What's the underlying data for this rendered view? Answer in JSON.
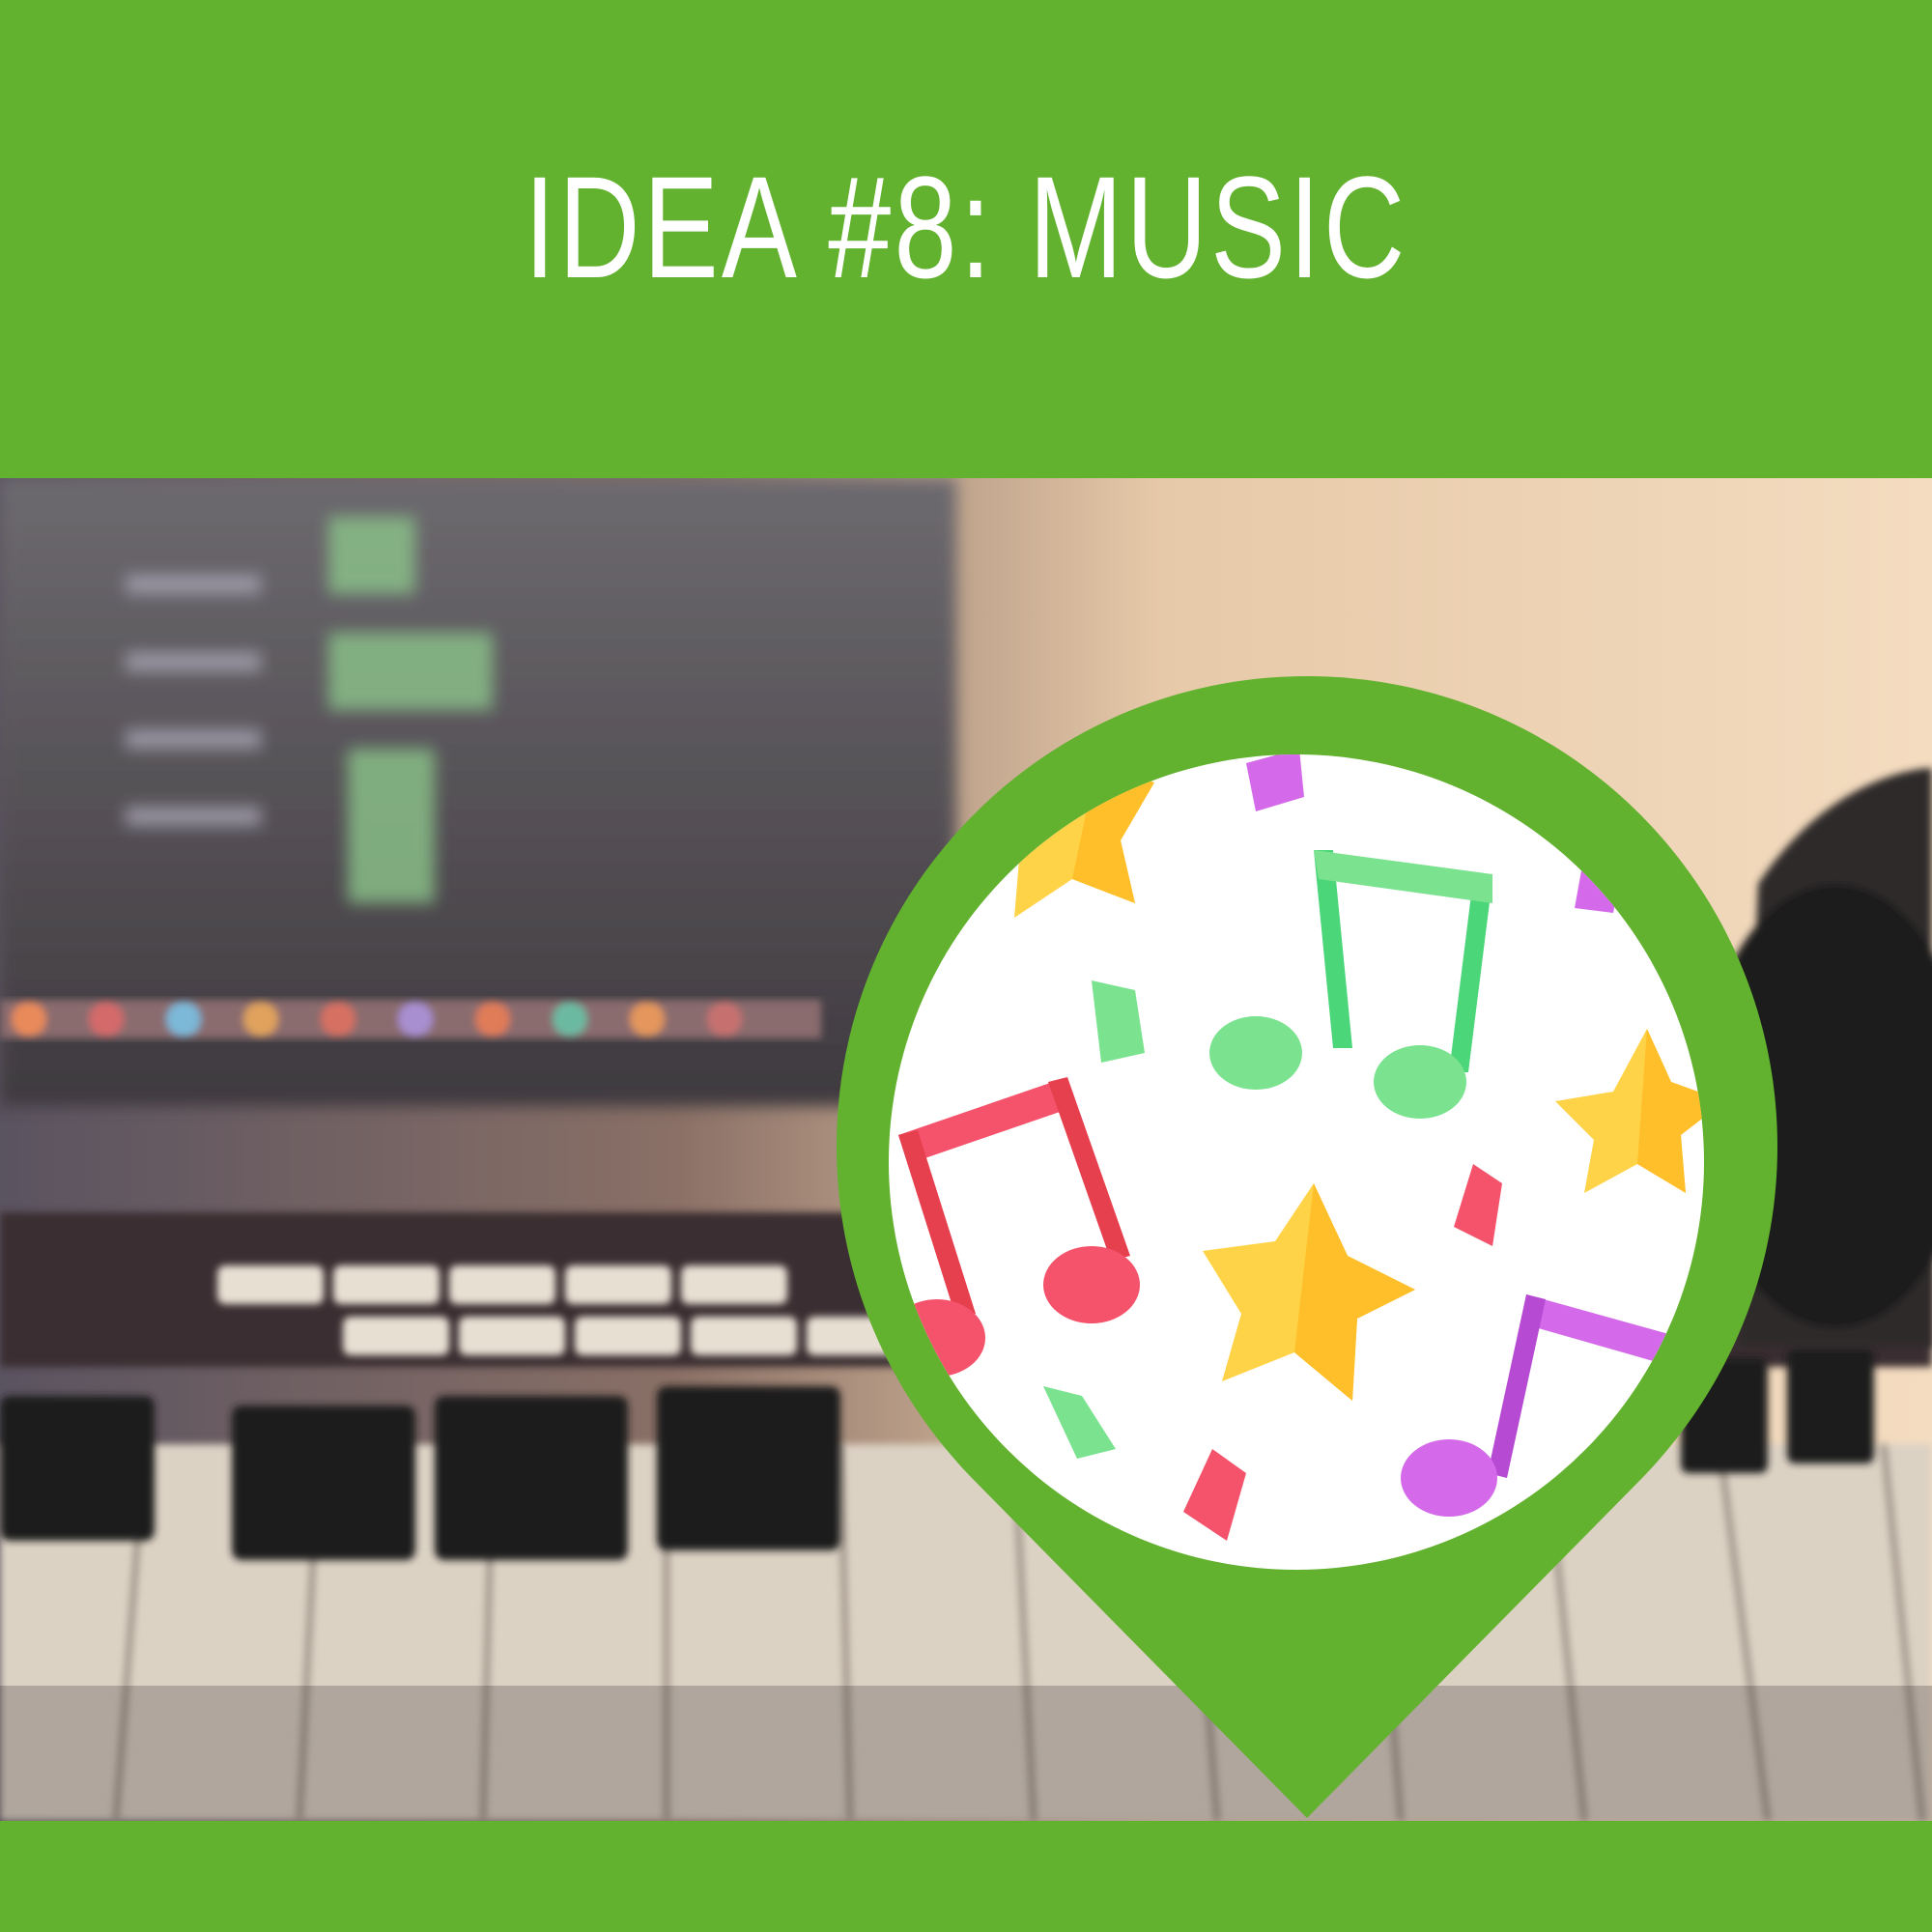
{
  "title": "IDEA #8: MUSIC",
  "colors": {
    "brand_green": "#62b22f",
    "note_green": "#7be38f",
    "note_red": "#f4536b",
    "note_purple": "#d46ae9",
    "star_yellow": "#ffd347"
  },
  "icons": [
    "music-notes-icon",
    "star-icon",
    "confetti-icon"
  ],
  "photo_subject": ""
}
